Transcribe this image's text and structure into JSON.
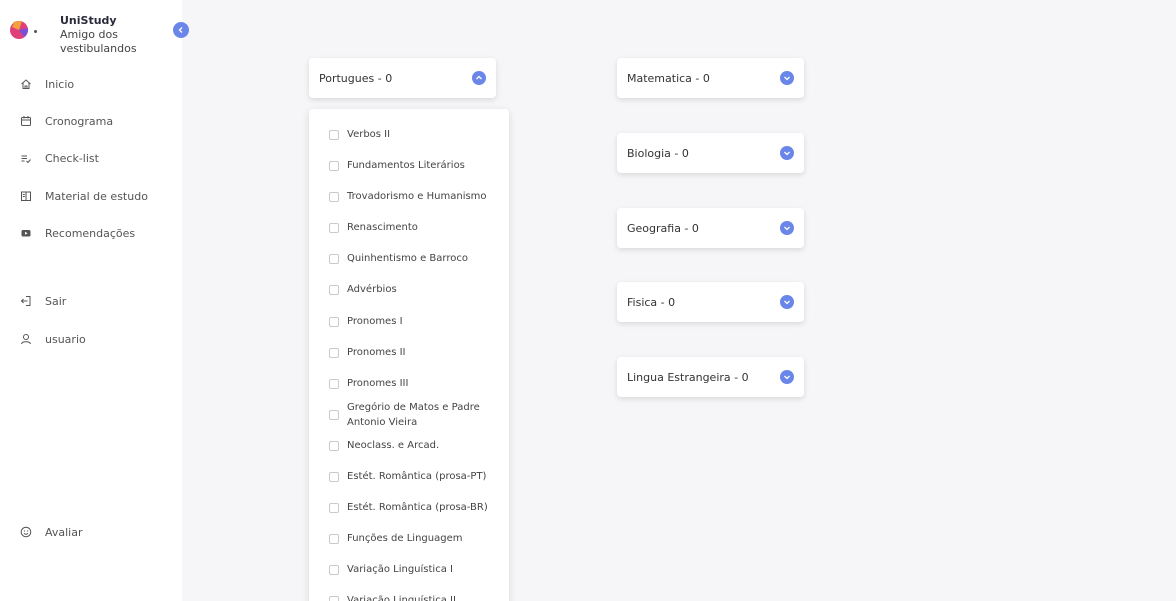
{
  "brand": {
    "title": "UniStudy",
    "subtitle": "Amigo dos vestibulandos"
  },
  "sidebar": {
    "items": [
      {
        "label": "Inicio",
        "icon": "home-icon"
      },
      {
        "label": "Cronograma",
        "icon": "calendar-icon"
      },
      {
        "label": "Check-list",
        "icon": "checklist-icon"
      },
      {
        "label": "Material de estudo",
        "icon": "book-icon"
      },
      {
        "label": "Recomendações",
        "icon": "video-icon"
      },
      {
        "label": "Sair",
        "icon": "logout-icon"
      },
      {
        "label": "usuario",
        "icon": "user-icon"
      },
      {
        "label": "Avaliar",
        "icon": "smile-icon"
      }
    ]
  },
  "subjects": {
    "portugues": "Portugues - 0",
    "matematica": "Matematica - 0",
    "biologia": "Biologia - 0",
    "geografia": "Geografia - 0",
    "fisica": "Fisica - 0",
    "lingua": "Lingua Estrangeira - 0"
  },
  "portugues_topics": [
    "Verbos II",
    "Fundamentos Literários",
    "Trovadorismo e Humanismo",
    "Renascimento",
    "Quinhentismo e Barroco",
    "Advérbios",
    "Pronomes I",
    "Pronomes II",
    "Pronomes III",
    "Gregório de Matos e Padre",
    "Antonio Vieira",
    "Neoclass. e Arcad.",
    "Estét. Romântica (prosa-PT)",
    "Estét. Romântica (prosa-BR)",
    "Funções de Linguagem",
    "Variação Linguística I",
    "Variação Linguística II"
  ],
  "colors": {
    "accent": "#6a86e8",
    "sidebar_bg": "#ffffff",
    "page_bg": "#f6f6f8"
  }
}
